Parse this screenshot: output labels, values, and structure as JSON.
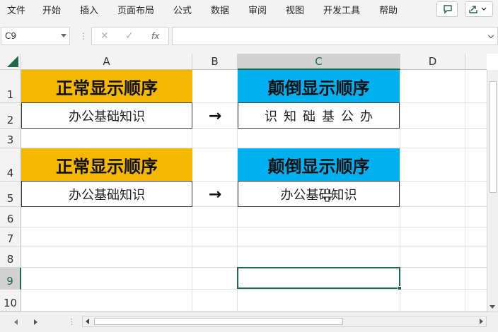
{
  "ribbon": {
    "menu": [
      "文件",
      "开始",
      "插入",
      "页面布局",
      "公式",
      "数据",
      "审阅",
      "视图",
      "开发工具",
      "帮助"
    ]
  },
  "formula_bar": {
    "name_box": "C9",
    "cancel_glyph": "✕",
    "enter_glyph": "✓",
    "fx_glyph": "fx",
    "value": ""
  },
  "columns": [
    "A",
    "B",
    "C",
    "D"
  ],
  "rows": [
    "1",
    "2",
    "3",
    "4",
    "5",
    "6",
    "7",
    "8",
    "9",
    "10"
  ],
  "cells": {
    "A1": "正常显示顺序",
    "A2": "办公基础知识",
    "B2": "→",
    "C1": "颠倒显示顺序",
    "C2": "识知础基公办",
    "A4": "正常显示顺序",
    "A5": "办公基础知识",
    "B5": "→",
    "C4": "颠倒显示顺序",
    "C5": "办公基础知识"
  },
  "selection": {
    "active_cell": "C9"
  },
  "colors": {
    "yellow_fill": "#f5b800",
    "blue_fill": "#00b0f0",
    "accent_green": "#1e6b46"
  },
  "icons": [
    "comment-icon",
    "share-icon",
    "select-all-icon",
    "cursor-icon"
  ]
}
